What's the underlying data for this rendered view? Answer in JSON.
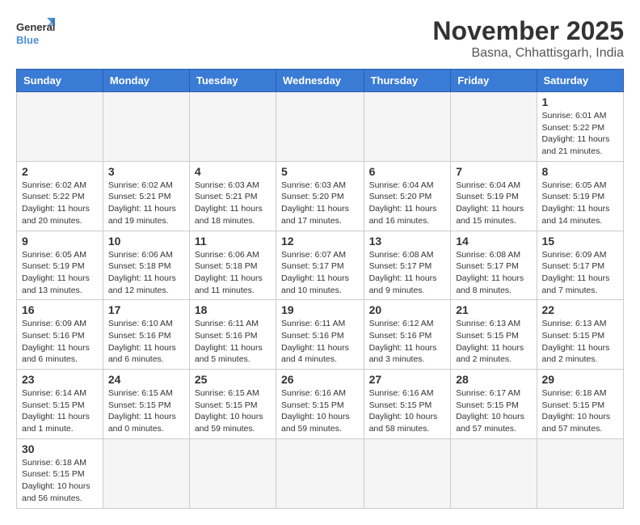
{
  "logo": {
    "general": "General",
    "blue": "Blue"
  },
  "title": {
    "month_year": "November 2025",
    "location": "Basna, Chhattisgarh, India"
  },
  "weekdays": [
    "Sunday",
    "Monday",
    "Tuesday",
    "Wednesday",
    "Thursday",
    "Friday",
    "Saturday"
  ],
  "days": {
    "d1": {
      "num": "1",
      "info": "Sunrise: 6:01 AM\nSunset: 5:22 PM\nDaylight: 11 hours and 21 minutes."
    },
    "d2": {
      "num": "2",
      "info": "Sunrise: 6:02 AM\nSunset: 5:22 PM\nDaylight: 11 hours and 20 minutes."
    },
    "d3": {
      "num": "3",
      "info": "Sunrise: 6:02 AM\nSunset: 5:21 PM\nDaylight: 11 hours and 19 minutes."
    },
    "d4": {
      "num": "4",
      "info": "Sunrise: 6:03 AM\nSunset: 5:21 PM\nDaylight: 11 hours and 18 minutes."
    },
    "d5": {
      "num": "5",
      "info": "Sunrise: 6:03 AM\nSunset: 5:20 PM\nDaylight: 11 hours and 17 minutes."
    },
    "d6": {
      "num": "6",
      "info": "Sunrise: 6:04 AM\nSunset: 5:20 PM\nDaylight: 11 hours and 16 minutes."
    },
    "d7": {
      "num": "7",
      "info": "Sunrise: 6:04 AM\nSunset: 5:19 PM\nDaylight: 11 hours and 15 minutes."
    },
    "d8": {
      "num": "8",
      "info": "Sunrise: 6:05 AM\nSunset: 5:19 PM\nDaylight: 11 hours and 14 minutes."
    },
    "d9": {
      "num": "9",
      "info": "Sunrise: 6:05 AM\nSunset: 5:19 PM\nDaylight: 11 hours and 13 minutes."
    },
    "d10": {
      "num": "10",
      "info": "Sunrise: 6:06 AM\nSunset: 5:18 PM\nDaylight: 11 hours and 12 minutes."
    },
    "d11": {
      "num": "11",
      "info": "Sunrise: 6:06 AM\nSunset: 5:18 PM\nDaylight: 11 hours and 11 minutes."
    },
    "d12": {
      "num": "12",
      "info": "Sunrise: 6:07 AM\nSunset: 5:17 PM\nDaylight: 11 hours and 10 minutes."
    },
    "d13": {
      "num": "13",
      "info": "Sunrise: 6:08 AM\nSunset: 5:17 PM\nDaylight: 11 hours and 9 minutes."
    },
    "d14": {
      "num": "14",
      "info": "Sunrise: 6:08 AM\nSunset: 5:17 PM\nDaylight: 11 hours and 8 minutes."
    },
    "d15": {
      "num": "15",
      "info": "Sunrise: 6:09 AM\nSunset: 5:17 PM\nDaylight: 11 hours and 7 minutes."
    },
    "d16": {
      "num": "16",
      "info": "Sunrise: 6:09 AM\nSunset: 5:16 PM\nDaylight: 11 hours and 6 minutes."
    },
    "d17": {
      "num": "17",
      "info": "Sunrise: 6:10 AM\nSunset: 5:16 PM\nDaylight: 11 hours and 6 minutes."
    },
    "d18": {
      "num": "18",
      "info": "Sunrise: 6:11 AM\nSunset: 5:16 PM\nDaylight: 11 hours and 5 minutes."
    },
    "d19": {
      "num": "19",
      "info": "Sunrise: 6:11 AM\nSunset: 5:16 PM\nDaylight: 11 hours and 4 minutes."
    },
    "d20": {
      "num": "20",
      "info": "Sunrise: 6:12 AM\nSunset: 5:16 PM\nDaylight: 11 hours and 3 minutes."
    },
    "d21": {
      "num": "21",
      "info": "Sunrise: 6:13 AM\nSunset: 5:15 PM\nDaylight: 11 hours and 2 minutes."
    },
    "d22": {
      "num": "22",
      "info": "Sunrise: 6:13 AM\nSunset: 5:15 PM\nDaylight: 11 hours and 2 minutes."
    },
    "d23": {
      "num": "23",
      "info": "Sunrise: 6:14 AM\nSunset: 5:15 PM\nDaylight: 11 hours and 1 minute."
    },
    "d24": {
      "num": "24",
      "info": "Sunrise: 6:15 AM\nSunset: 5:15 PM\nDaylight: 11 hours and 0 minutes."
    },
    "d25": {
      "num": "25",
      "info": "Sunrise: 6:15 AM\nSunset: 5:15 PM\nDaylight: 10 hours and 59 minutes."
    },
    "d26": {
      "num": "26",
      "info": "Sunrise: 6:16 AM\nSunset: 5:15 PM\nDaylight: 10 hours and 59 minutes."
    },
    "d27": {
      "num": "27",
      "info": "Sunrise: 6:16 AM\nSunset: 5:15 PM\nDaylight: 10 hours and 58 minutes."
    },
    "d28": {
      "num": "28",
      "info": "Sunrise: 6:17 AM\nSunset: 5:15 PM\nDaylight: 10 hours and 57 minutes."
    },
    "d29": {
      "num": "29",
      "info": "Sunrise: 6:18 AM\nSunset: 5:15 PM\nDaylight: 10 hours and 57 minutes."
    },
    "d30": {
      "num": "30",
      "info": "Sunrise: 6:18 AM\nSunset: 5:15 PM\nDaylight: 10 hours and 56 minutes."
    }
  }
}
